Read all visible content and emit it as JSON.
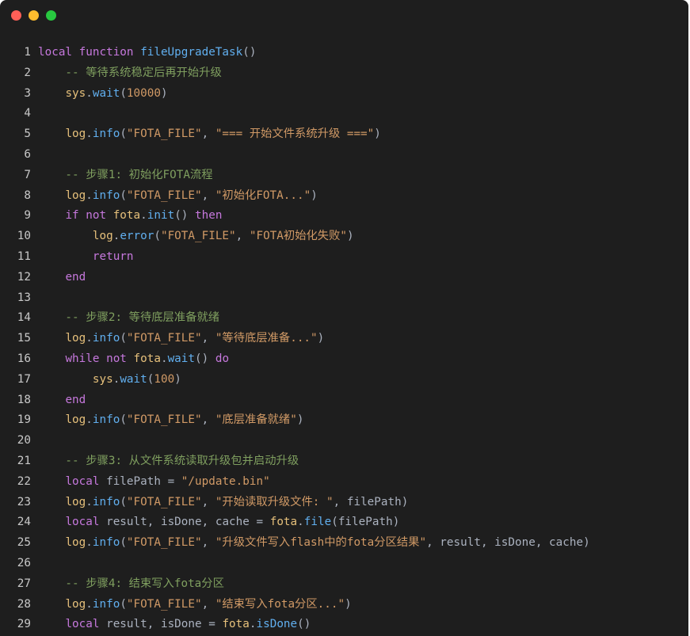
{
  "window": {
    "traffic_lights": [
      "close",
      "minimize",
      "zoom"
    ],
    "colors": {
      "close": "#ff5f57",
      "minimize": "#febc2e",
      "zoom": "#28c840",
      "background": "#1e1e1e"
    }
  },
  "code": {
    "language": "lua",
    "lines": [
      {
        "n": "1",
        "tokens": [
          [
            "kw",
            "local "
          ],
          [
            "kw",
            "function "
          ],
          [
            "fn",
            "fileUpgradeTask"
          ],
          [
            "pl",
            "()"
          ]
        ]
      },
      {
        "n": "2",
        "tokens": [
          [
            "cm",
            "    -- 等待系统稳定后再开始升级"
          ]
        ]
      },
      {
        "n": "3",
        "tokens": [
          [
            "pl",
            "    "
          ],
          [
            "id",
            "sys"
          ],
          [
            "pl",
            "."
          ],
          [
            "fn",
            "wait"
          ],
          [
            "pl",
            "("
          ],
          [
            "nm",
            "10000"
          ],
          [
            "pl",
            ")"
          ]
        ]
      },
      {
        "n": "4",
        "tokens": []
      },
      {
        "n": "5",
        "tokens": [
          [
            "pl",
            "    "
          ],
          [
            "id",
            "log"
          ],
          [
            "pl",
            "."
          ],
          [
            "fn",
            "info"
          ],
          [
            "pl",
            "("
          ],
          [
            "st",
            "\"FOTA_FILE\""
          ],
          [
            "pl",
            ", "
          ],
          [
            "st",
            "\"=== 开始文件系统升级 ===\""
          ],
          [
            "pl",
            ")"
          ]
        ]
      },
      {
        "n": "6",
        "tokens": []
      },
      {
        "n": "7",
        "tokens": [
          [
            "cm",
            "    -- 步骤1: 初始化FOTA流程"
          ]
        ]
      },
      {
        "n": "8",
        "tokens": [
          [
            "pl",
            "    "
          ],
          [
            "id",
            "log"
          ],
          [
            "pl",
            "."
          ],
          [
            "fn",
            "info"
          ],
          [
            "pl",
            "("
          ],
          [
            "st",
            "\"FOTA_FILE\""
          ],
          [
            "pl",
            ", "
          ],
          [
            "st",
            "\"初始化FOTA...\""
          ],
          [
            "pl",
            ")"
          ]
        ]
      },
      {
        "n": "9",
        "tokens": [
          [
            "pl",
            "    "
          ],
          [
            "kw",
            "if "
          ],
          [
            "kw",
            "not "
          ],
          [
            "id",
            "fota"
          ],
          [
            "pl",
            "."
          ],
          [
            "fn",
            "init"
          ],
          [
            "pl",
            "() "
          ],
          [
            "kw",
            "then"
          ]
        ]
      },
      {
        "n": "10",
        "tokens": [
          [
            "pl",
            "        "
          ],
          [
            "id",
            "log"
          ],
          [
            "pl",
            "."
          ],
          [
            "fn",
            "error"
          ],
          [
            "pl",
            "("
          ],
          [
            "st",
            "\"FOTA_FILE\""
          ],
          [
            "pl",
            ", "
          ],
          [
            "st",
            "\"FOTA初始化失败\""
          ],
          [
            "pl",
            ")"
          ]
        ]
      },
      {
        "n": "11",
        "tokens": [
          [
            "pl",
            "        "
          ],
          [
            "kw",
            "return"
          ]
        ]
      },
      {
        "n": "12",
        "tokens": [
          [
            "pl",
            "    "
          ],
          [
            "kw",
            "end"
          ]
        ]
      },
      {
        "n": "13",
        "tokens": []
      },
      {
        "n": "14",
        "tokens": [
          [
            "cm",
            "    -- 步骤2: 等待底层准备就绪"
          ]
        ]
      },
      {
        "n": "15",
        "tokens": [
          [
            "pl",
            "    "
          ],
          [
            "id",
            "log"
          ],
          [
            "pl",
            "."
          ],
          [
            "fn",
            "info"
          ],
          [
            "pl",
            "("
          ],
          [
            "st",
            "\"FOTA_FILE\""
          ],
          [
            "pl",
            ", "
          ],
          [
            "st",
            "\"等待底层准备...\""
          ],
          [
            "pl",
            ")"
          ]
        ]
      },
      {
        "n": "16",
        "tokens": [
          [
            "pl",
            "    "
          ],
          [
            "kw",
            "while "
          ],
          [
            "kw",
            "not "
          ],
          [
            "id",
            "fota"
          ],
          [
            "pl",
            "."
          ],
          [
            "fn",
            "wait"
          ],
          [
            "pl",
            "() "
          ],
          [
            "kw",
            "do"
          ]
        ]
      },
      {
        "n": "17",
        "tokens": [
          [
            "pl",
            "        "
          ],
          [
            "id",
            "sys"
          ],
          [
            "pl",
            "."
          ],
          [
            "fn",
            "wait"
          ],
          [
            "pl",
            "("
          ],
          [
            "nm",
            "100"
          ],
          [
            "pl",
            ")"
          ]
        ]
      },
      {
        "n": "18",
        "tokens": [
          [
            "pl",
            "    "
          ],
          [
            "kw",
            "end"
          ]
        ]
      },
      {
        "n": "19",
        "tokens": [
          [
            "pl",
            "    "
          ],
          [
            "id",
            "log"
          ],
          [
            "pl",
            "."
          ],
          [
            "fn",
            "info"
          ],
          [
            "pl",
            "("
          ],
          [
            "st",
            "\"FOTA_FILE\""
          ],
          [
            "pl",
            ", "
          ],
          [
            "st",
            "\"底层准备就绪\""
          ],
          [
            "pl",
            ")"
          ]
        ]
      },
      {
        "n": "20",
        "tokens": []
      },
      {
        "n": "21",
        "tokens": [
          [
            "cm",
            "    -- 步骤3: 从文件系统读取升级包并启动升级"
          ]
        ]
      },
      {
        "n": "22",
        "tokens": [
          [
            "pl",
            "    "
          ],
          [
            "kw",
            "local "
          ],
          [
            "vr",
            "filePath"
          ],
          [
            "pl",
            " = "
          ],
          [
            "st",
            "\"/update.bin\""
          ]
        ]
      },
      {
        "n": "23",
        "tokens": [
          [
            "pl",
            "    "
          ],
          [
            "id",
            "log"
          ],
          [
            "pl",
            "."
          ],
          [
            "fn",
            "info"
          ],
          [
            "pl",
            "("
          ],
          [
            "st",
            "\"FOTA_FILE\""
          ],
          [
            "pl",
            ", "
          ],
          [
            "st",
            "\"开始读取升级文件: \""
          ],
          [
            "pl",
            ", "
          ],
          [
            "vr",
            "filePath"
          ],
          [
            "pl",
            ")"
          ]
        ]
      },
      {
        "n": "24",
        "tokens": [
          [
            "pl",
            "    "
          ],
          [
            "kw",
            "local "
          ],
          [
            "vr",
            "result"
          ],
          [
            "pl",
            ", "
          ],
          [
            "vr",
            "isDone"
          ],
          [
            "pl",
            ", "
          ],
          [
            "vr",
            "cache"
          ],
          [
            "pl",
            " = "
          ],
          [
            "id",
            "fota"
          ],
          [
            "pl",
            "."
          ],
          [
            "fn",
            "file"
          ],
          [
            "pl",
            "("
          ],
          [
            "vr",
            "filePath"
          ],
          [
            "pl",
            ")"
          ]
        ]
      },
      {
        "n": "25",
        "tokens": [
          [
            "pl",
            "    "
          ],
          [
            "id",
            "log"
          ],
          [
            "pl",
            "."
          ],
          [
            "fn",
            "info"
          ],
          [
            "pl",
            "("
          ],
          [
            "st",
            "\"FOTA_FILE\""
          ],
          [
            "pl",
            ", "
          ],
          [
            "st",
            "\"升级文件写入flash中的fota分区结果\""
          ],
          [
            "pl",
            ", "
          ],
          [
            "vr",
            "result"
          ],
          [
            "pl",
            ", "
          ],
          [
            "vr",
            "isDone"
          ],
          [
            "pl",
            ", "
          ],
          [
            "vr",
            "cache"
          ],
          [
            "pl",
            ")"
          ]
        ]
      },
      {
        "n": "26",
        "tokens": []
      },
      {
        "n": "27",
        "tokens": [
          [
            "cm",
            "    -- 步骤4: 结束写入fota分区"
          ]
        ]
      },
      {
        "n": "28",
        "tokens": [
          [
            "pl",
            "    "
          ],
          [
            "id",
            "log"
          ],
          [
            "pl",
            "."
          ],
          [
            "fn",
            "info"
          ],
          [
            "pl",
            "("
          ],
          [
            "st",
            "\"FOTA_FILE\""
          ],
          [
            "pl",
            ", "
          ],
          [
            "st",
            "\"结束写入fota分区...\""
          ],
          [
            "pl",
            ")"
          ]
        ]
      },
      {
        "n": "29",
        "tokens": [
          [
            "pl",
            "    "
          ],
          [
            "kw",
            "local "
          ],
          [
            "vr",
            "result"
          ],
          [
            "pl",
            ", "
          ],
          [
            "vr",
            "isDone"
          ],
          [
            "pl",
            " = "
          ],
          [
            "id",
            "fota"
          ],
          [
            "pl",
            "."
          ],
          [
            "fn",
            "isDone"
          ],
          [
            "pl",
            "()"
          ]
        ]
      }
    ]
  }
}
